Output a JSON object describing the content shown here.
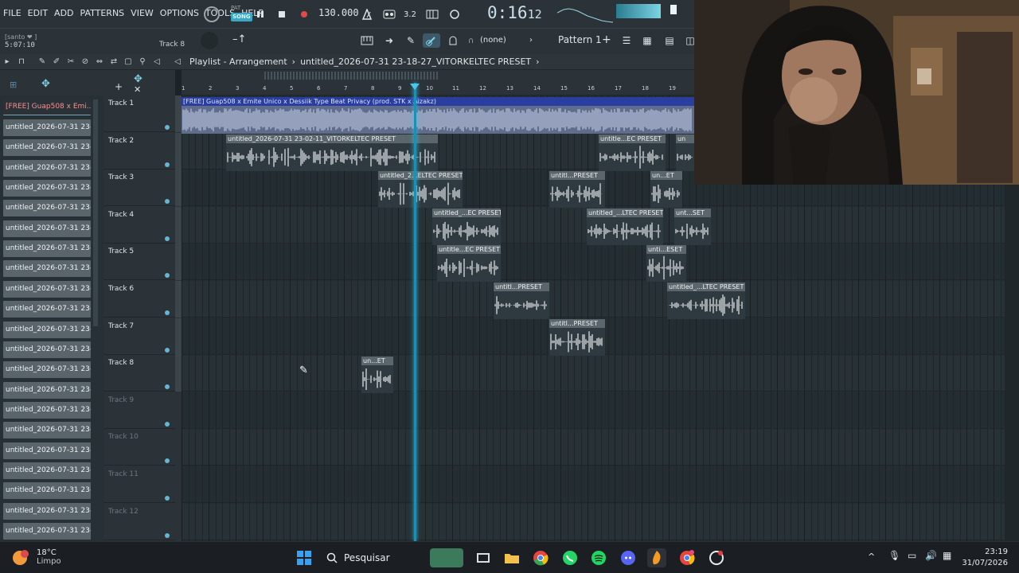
{
  "menu": [
    "FILE",
    "EDIT",
    "ADD",
    "PATTERNS",
    "VIEW",
    "OPTIONS",
    "TOOLS",
    "HELP"
  ],
  "transport": {
    "mode_pat": "PAT",
    "mode_song": "SONG",
    "tempo": "130.000",
    "time": "0:16",
    "time_small": "12",
    "song_position": "5:07:10",
    "hint": "[santo ❤ ]"
  },
  "toolbar2": {
    "track_label": "Track 8",
    "snap": "(none)",
    "pattern": "Pattern 1"
  },
  "playlist": {
    "title": "Playlist - Arrangement",
    "separator": "›",
    "project": "untitled_2026-07-31 23-18-27_VITORKELTEC PRESET"
  },
  "picker": {
    "selected": "[FREE] Guap508 x Emi...",
    "items": [
      "untitled_2026-07-31 23-...",
      "untitled_2026-07-31 23-...",
      "untitled_2026-07-31 23-...",
      "untitled_2026-07-31 23-...",
      "untitled_2026-07-31 23-...",
      "untitled_2026-07-31 23-...",
      "untitled_2026-07-31 23-...",
      "untitled_2026-07-31 23-...",
      "untitled_2026-07-31 23-...",
      "untitled_2026-07-31 23-...",
      "untitled_2026-07-31 23-...",
      "untitled_2026-07-31 23-...",
      "untitled_2026-07-31 23-...",
      "untitled_2026-07-31 23-...",
      "untitled_2026-07-31 23-...",
      "untitled_2026-07-31 23-...",
      "untitled_2026-07-31 23-...",
      "untitled_2026-07-31 23-...",
      "untitled_2026-07-31 23-...",
      "untitled_2026-07-31 23-...",
      "untitled_2026-07-31 23-..."
    ]
  },
  "tracks": [
    "Track 1",
    "Track 2",
    "Track 3",
    "Track 4",
    "Track 5",
    "Track 6",
    "Track 7",
    "Track 8",
    "Track 9",
    "Track 10",
    "Track 11",
    "Track 12"
  ],
  "ruler_bars": [
    "1",
    "2",
    "3",
    "4",
    "5",
    "6",
    "7",
    "8",
    "9",
    "10",
    "11",
    "12",
    "13",
    "14",
    "15",
    "16",
    "17",
    "18",
    "19"
  ],
  "clips": {
    "t1_main": "[FREE] Guap508 x Emite Unico x Dessiik Type Beat Privacy (prod. STK x Aizakz)",
    "t2_a": "untitled_2026-07-31 23-02-11_VITORKELTEC PRESET",
    "t2_b": "untitle...EC PRESET",
    "t2_c": "un",
    "t3_a": "untitled_2...ELTEC PRESET",
    "t3_b": "untitl...PRESET",
    "t3_c": "un...ET",
    "t4_a": "untitled_...EC PRESET",
    "t4_b": "untitled_...LTEC PRESET",
    "t4_c": "unt...SET",
    "t5_a": "untitle...EC PRESET",
    "t5_b": "unti...ESET",
    "t6_a": "untitl...PRESET",
    "t6_b": "untitled_...LTEC PRESET",
    "t7_a": "untitl...PRESET",
    "t8_a": "un...ET"
  },
  "taskbar": {
    "temp": "18°C",
    "weather": "Limpo",
    "search": "Pesquisar",
    "time": "23:19",
    "date": "31/07/2026"
  }
}
